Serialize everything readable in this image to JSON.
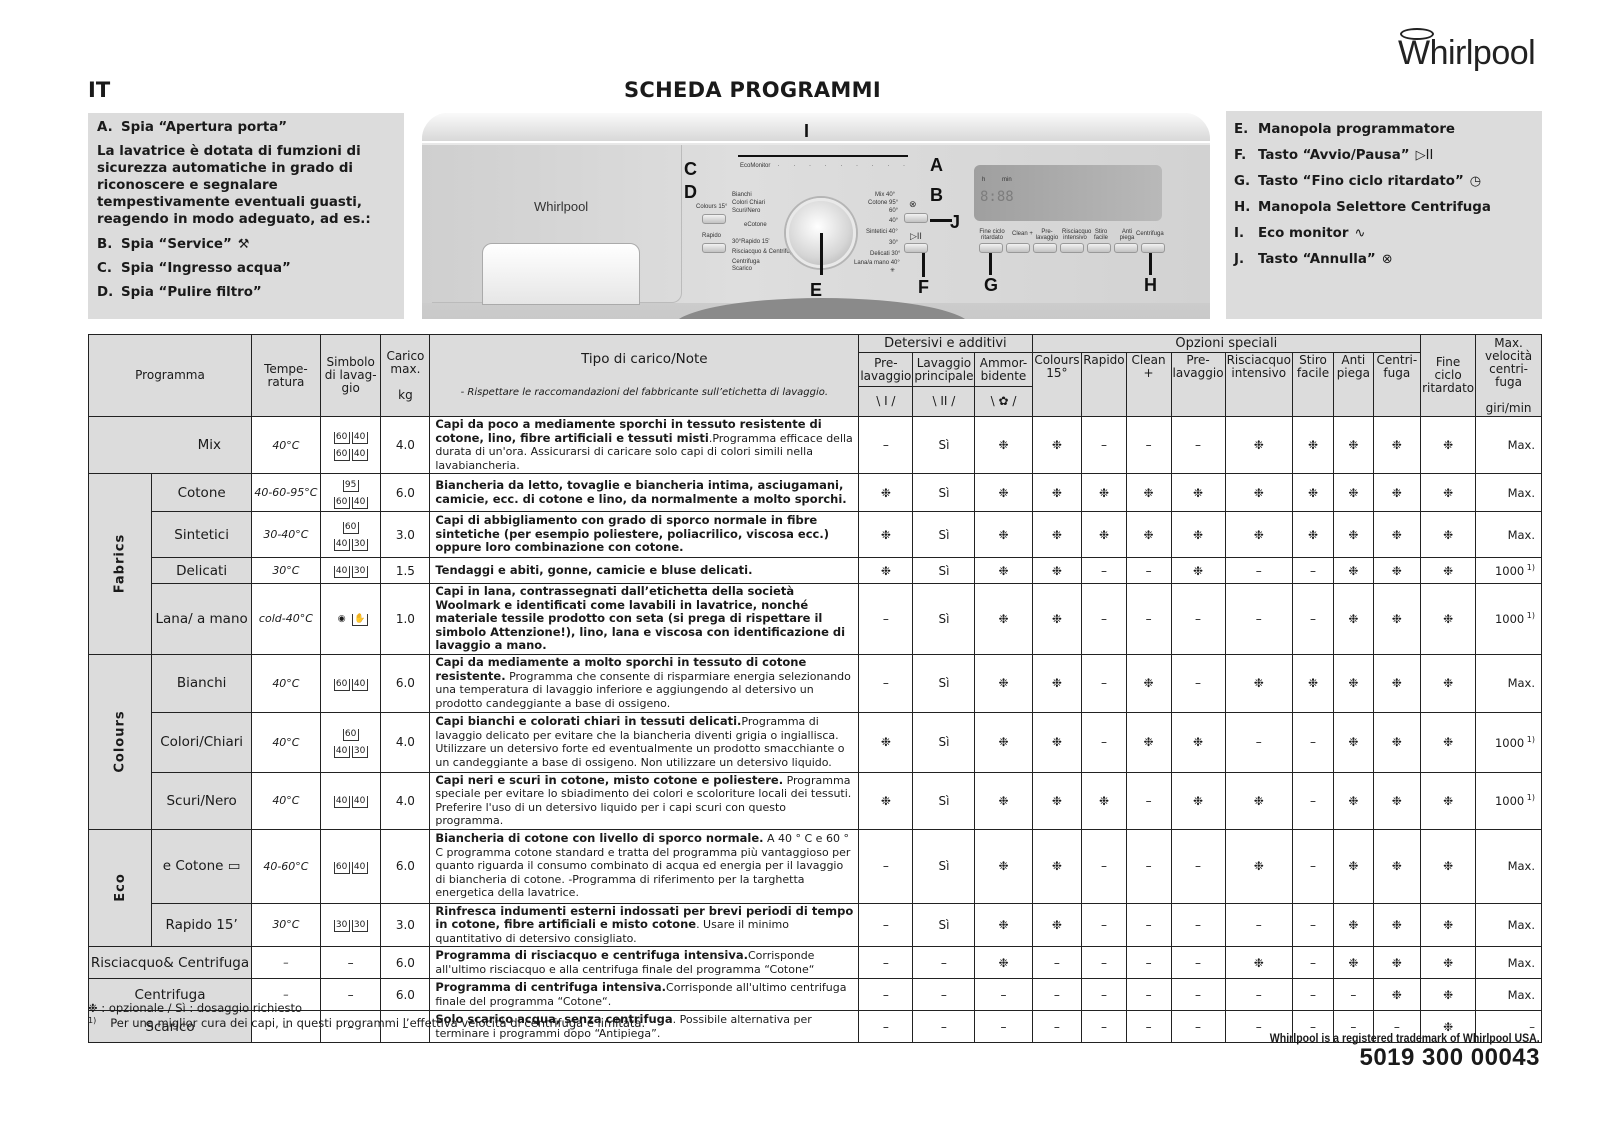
{
  "brand": "Whirlpool",
  "lang": "IT",
  "title": "SCHEDA PROGRAMMI",
  "left_box": {
    "item_a": {
      "key": "A.",
      "label": "Spia “Apertura porta”"
    },
    "intro": "La lavatrice è dotata di fumzioni di sicurezza automatiche in grado di riconoscere e segnalare tempestivamente eventuali guasti, reagendo in modo adeguato, ad es.:",
    "items": [
      {
        "key": "B.",
        "label": "Spia “Service”",
        "icon": "⚒"
      },
      {
        "key": "C.",
        "label": "Spia “Ingresso acqua”",
        "icon": ""
      },
      {
        "key": "D.",
        "label": "Spia “Pulire filtro”",
        "icon": ""
      }
    ]
  },
  "right_box": {
    "items": [
      {
        "key": "E.",
        "label": "Manopola programmatore",
        "icon": ""
      },
      {
        "key": "F.",
        "label": "Tasto “Avvio/Pausa”",
        "icon": "▷II"
      },
      {
        "key": "G.",
        "label": "Tasto “Fino ciclo ritardato”",
        "icon": "◷"
      },
      {
        "key": "H.",
        "label": "Manopola Selettore Centrifuga",
        "icon": ""
      },
      {
        "key": "I.",
        "label": "Eco monitor",
        "icon": "∿"
      },
      {
        "key": "J.",
        "label": "Tasto “Annulla”",
        "icon": "⊗"
      }
    ]
  },
  "machine": {
    "callouts": [
      "A",
      "B",
      "C",
      "D",
      "E",
      "F",
      "G",
      "H",
      "I",
      "J"
    ],
    "eco_monitor": "EcoMonitor",
    "dial_left": [
      "Bianchi",
      "Colori Chiari",
      "Scuri/Nero",
      "eCotone",
      "30°Rapido 15'",
      "Risciacquo & Centrifuga",
      "Centrifuga",
      "Scarico"
    ],
    "dial_right": [
      "Mix 40°",
      "Cotone 95°",
      "60°",
      "40°",
      "Sintetici 40°",
      "30°",
      "Delicati 30°",
      "Lana/a mano 40°",
      "✳"
    ],
    "left_buttons": [
      "Colours 15°",
      "Rapido"
    ],
    "display_digits": "8:88",
    "display_units": [
      "h",
      "min"
    ],
    "option_buttons": [
      "Fine ciclo ritardato",
      "Clean +",
      "Pre-lavaggio",
      "Risciacquo intensivo",
      "Stiro facile",
      "Anti piega",
      "Centrifuga"
    ]
  },
  "table": {
    "headers": {
      "programma": "Programma",
      "temperatura": "Tempe-ratura",
      "simbolo": "Simbolo di lavag-gio",
      "carico": "Carico max.",
      "carico_unit": "kg",
      "note": "Tipo di carico/Note",
      "note_sub": "- Rispettare le raccomandazioni del fabbricante sull’etichetta di lavaggio.",
      "detersivi_group": "Detersivi e additivi",
      "detersivi": [
        {
          "label": "Pre-lavaggio",
          "symbol": "\\ I /"
        },
        {
          "label": "Lavaggio principale",
          "symbol": "\\ II /"
        },
        {
          "label": "Ammor-bidente",
          "symbol": "\\ ✿ /"
        }
      ],
      "opzioni_group": "Opzioni speciali",
      "opzioni": [
        "Colours 15°",
        "Rapido",
        "Clean +",
        "Pre-lavaggio",
        "Risciacquo intensivo",
        "Stiro facile",
        "Anti piega",
        "Centri-fuga"
      ],
      "fine_ciclo": "Fine ciclo ritardato",
      "max_vel": "Max. velocità centri-fuga",
      "max_vel_unit": "giri/min"
    },
    "groups": {
      "fabrics": "Fabrics",
      "colours": "Colours",
      "eco": "Eco"
    },
    "rows": [
      {
        "name": "Mix",
        "temp": "40°C",
        "symbols": [
          "60",
          "40",
          "60",
          "40"
        ],
        "load": "4.0",
        "note_bold": "Capi da poco a mediamente sporchi in tessuto resistente di cotone, lino, fibre artificiali e tessuti misti",
        "note": ".Programma efficace della durata di un'ora. Assicurarsi di caricare solo capi di colori simili nella lavabiancheria.",
        "cells": [
          "–",
          "Sì",
          "❉",
          "❉",
          "–",
          "–",
          "–",
          "❉",
          "❉",
          "❉",
          "❉",
          "❉"
        ],
        "spin": "Max.",
        "spin_note": ""
      },
      {
        "name": "Cotone",
        "temp": "40-60-95°C",
        "symbols": [
          "95",
          "60",
          "40"
        ],
        "load": "6.0",
        "note_bold": "Biancheria da letto, tovaglie e biancheria intima, asciugamani, camicie, ecc. di cotone e lino, da normalmente a molto sporchi.",
        "note": "",
        "cells": [
          "❉",
          "Sì",
          "❉",
          "❉",
          "❉",
          "❉",
          "❉",
          "❉",
          "❉",
          "❉",
          "❉",
          "❉"
        ],
        "spin": "Max.",
        "spin_note": ""
      },
      {
        "name": "Sintetici",
        "temp": "30-40°C",
        "symbols": [
          "60",
          "40",
          "30"
        ],
        "load": "3.0",
        "note_bold": "Capi di abbigliamento con grado di sporco normale in fibre sintetiche (per esempio poliestere, poliacrilico, viscosa ecc.) oppure loro combinazione con cotone.",
        "note": "",
        "cells": [
          "❉",
          "Sì",
          "❉",
          "❉",
          "❉",
          "❉",
          "❉",
          "❉",
          "❉",
          "❉",
          "❉",
          "❉"
        ],
        "spin": "Max.",
        "spin_note": ""
      },
      {
        "name": "Delicati",
        "temp": "30°C",
        "symbols": [
          "40",
          "30"
        ],
        "load": "1.5",
        "note_bold": "Tendaggi e abiti, gonne, camicie e bluse delicati.",
        "note": "",
        "cells": [
          "❉",
          "Sì",
          "❉",
          "❉",
          "–",
          "–",
          "❉",
          "–",
          "–",
          "❉",
          "❉",
          "❉"
        ],
        "spin": "1000",
        "spin_note": "1)"
      },
      {
        "name": "Lana/ a mano",
        "temp": "cold-40°C",
        "symbols": [
          "wool",
          "hand"
        ],
        "load": "1.0",
        "note_bold": "Capi in lana, contrassegnati dall’etichetta della società Woolmark e identificati come lavabili in lavatrice, nonché materiale tessile prodotto con seta (si prega di rispettare il simbolo Attenzione!), lino, lana e viscosa con identificazione di lavaggio a mano.",
        "note": "",
        "cells": [
          "–",
          "Sì",
          "❉",
          "❉",
          "–",
          "–",
          "–",
          "–",
          "–",
          "❉",
          "❉",
          "❉"
        ],
        "spin": "1000",
        "spin_note": "1)"
      },
      {
        "name": "Bianchi",
        "temp": "40°C",
        "symbols": [
          "60",
          "40"
        ],
        "load": "6.0",
        "note_bold": "Capi da mediamente a molto sporchi in tessuto di cotone resistente.",
        "note": " Programma che consente di risparmiare energia selezionando una temperatura di lavaggio inferiore e aggiungendo al detersivo un prodotto candeggiante a base di ossigeno.",
        "cells": [
          "–",
          "Sì",
          "❉",
          "❉",
          "–",
          "❉",
          "–",
          "❉",
          "❉",
          "❉",
          "❉",
          "❉"
        ],
        "spin": "Max.",
        "spin_note": ""
      },
      {
        "name": "Colori/Chiari",
        "temp": "40°C",
        "symbols": [
          "60",
          "40",
          "30"
        ],
        "load": "4.0",
        "note_bold": "Capi bianchi e colorati chiari in tessuti delicati.",
        "note": "Programma di lavaggio delicato per evitare che la biancheria diventi grigia o ingiallisca. Utilizzare un detersivo forte ed eventualmente un prodotto smacchiante o un candeggiante a base di ossigeno. Non utilizzare un detersivo liquido.",
        "cells": [
          "❉",
          "Sì",
          "❉",
          "❉",
          "–",
          "❉",
          "❉",
          "–",
          "–",
          "❉",
          "❉",
          "❉"
        ],
        "spin": "1000",
        "spin_note": "1)"
      },
      {
        "name": "Scuri/Nero",
        "temp": "40°C",
        "symbols": [
          "40",
          "40"
        ],
        "load": "4.0",
        "note_bold": "Capi neri e scuri in cotone, misto cotone e poliestere.",
        "note": " Programma speciale per evitare lo sbiadimento dei colori e scoloriture locali dei tessuti. Preferire l'uso di un detersivo liquido per i capi scuri con questo programma.",
        "cells": [
          "❉",
          "Sì",
          "❉",
          "❉",
          "❉",
          "–",
          "❉",
          "❉",
          "–",
          "❉",
          "❉",
          "❉"
        ],
        "spin": "1000",
        "spin_note": "1)"
      },
      {
        "name": "Cotone",
        "prefix": "e",
        "temp": "40-60°C",
        "symbols": [
          "60",
          "40"
        ],
        "load": "6.0",
        "note_bold": "Biancheria di cotone con livello di sporco normale.",
        "note": " A 40 ° C e 60 ° C programma cotone standard e tratta del programma più vantaggioso per quanto riguarda il consumo combinato di acqua ed energia per il lavaggio di biancheria di cotone. -Programma di riferimento per la targhetta energetica della lavatrice.",
        "cells": [
          "–",
          "Sì",
          "❉",
          "❉",
          "–",
          "–",
          "–",
          "❉",
          "–",
          "❉",
          "❉",
          "❉"
        ],
        "spin": "Max.",
        "spin_note": ""
      },
      {
        "name": "Rapido 15’",
        "temp": "30°C",
        "symbols": [
          "30",
          "30"
        ],
        "load": "3.0",
        "note_bold": "Rinfresca indumenti esterni indossati per brevi periodi di tempo in cotone, fibre artificiali e misto cotone",
        "note": ". Usare il minimo quantitativo di detersivo consigliato.",
        "cells": [
          "–",
          "Sì",
          "❉",
          "❉",
          "–",
          "–",
          "–",
          "–",
          "–",
          "❉",
          "❉",
          "❉"
        ],
        "spin": "Max.",
        "spin_note": ""
      },
      {
        "name": "Risciacquo& Centrifuga",
        "temp": "–",
        "symbols": [],
        "symbol_text": "–",
        "load": "6.0",
        "note_bold": "Programma di risciacquo e centrifuga intensiva.",
        "note": "Corrisponde all'ultimo risciacquo e alla centrifuga finale del programma “Cotone“",
        "cells": [
          "–",
          "–",
          "❉",
          "–",
          "–",
          "–",
          "–",
          "❉",
          "–",
          "❉",
          "❉",
          "❉"
        ],
        "spin": "Max.",
        "spin_note": ""
      },
      {
        "name": "Centrifuga",
        "temp": "–",
        "symbols": [],
        "symbol_text": "–",
        "load": "6.0",
        "note_bold": "Programma di centrifuga intensiva.",
        "note": "Corrisponde all'ultimo centrifuga finale del programma “Cotone“.",
        "cells": [
          "–",
          "–",
          "–",
          "–",
          "–",
          "–",
          "–",
          "–",
          "–",
          "–",
          "❉",
          "❉"
        ],
        "spin": "Max.",
        "spin_note": ""
      },
      {
        "name": "Scarico",
        "temp": "–",
        "symbols": [],
        "symbol_text": "–",
        "load": "–",
        "note_bold": "Solo scarico acqua, senza centrifuga",
        "note": ". Possibile alternativa per terminare i programmi dopo “Antipiega”.",
        "cells": [
          "–",
          "–",
          "–",
          "–",
          "–",
          "–",
          "–",
          "–",
          "–",
          "–",
          "–",
          "❉"
        ],
        "spin": "–",
        "spin_note": ""
      }
    ]
  },
  "footer": {
    "legend": "❉ :  opzionale / Sì : dosaggio richiesto",
    "note_mark": "1)",
    "note": "Per una miglior cura dei capi, in questi programmi l’effettiva velocità di centrifuga è limitata.",
    "trademark": "Whirlpool is a registered trademark of Whirlpool USA.",
    "code": "5019 300 00043"
  }
}
